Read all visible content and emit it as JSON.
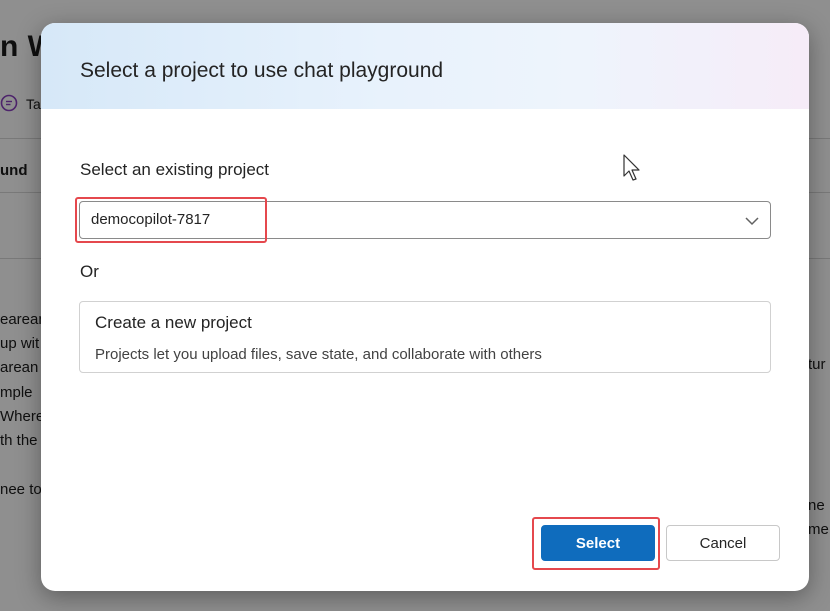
{
  "background": {
    "title": "n W",
    "tab_label": "Ta",
    "column_header": "und",
    "left_fragments": [
      "earean",
      "up wit",
      "arean",
      "mple",
      "Where",
      "th the",
      "nee to"
    ],
    "right_fragments": [
      "tur",
      "ne",
      "me"
    ]
  },
  "dialog": {
    "title": "Select a project to use chat playground",
    "existing_label": "Select an existing project",
    "selected_project": "democopilot-7817",
    "or_label": "Or",
    "create": {
      "title": "Create a new project",
      "description": "Projects let you upload files, save state, and collaborate with others"
    },
    "buttons": {
      "select": "Select",
      "cancel": "Cancel"
    }
  },
  "colors": {
    "primary": "#0f6cbd",
    "highlight": "#e5484d"
  }
}
